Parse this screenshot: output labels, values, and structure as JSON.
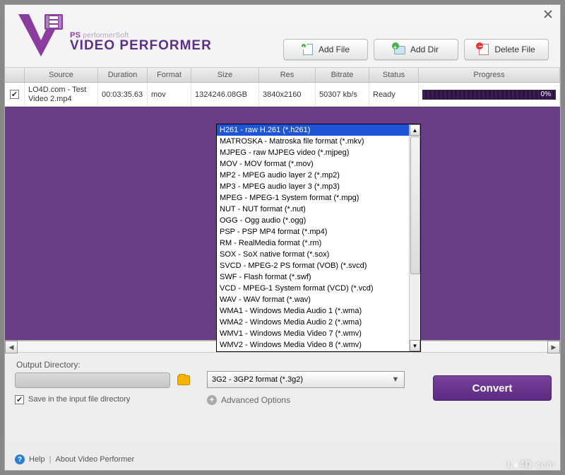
{
  "branding": {
    "sub_prefix": "PS",
    "sub_name": "performerSoft",
    "title": "VIDEO PERFORMER"
  },
  "toolbar": {
    "add_file": "Add File",
    "add_dir": "Add Dir",
    "delete_file": "Delete File"
  },
  "columns": {
    "source": "Source",
    "duration": "Duration",
    "format": "Format",
    "size": "Size",
    "res": "Res",
    "bitrate": "Bitrate",
    "status": "Status",
    "progress": "Progress"
  },
  "rows": [
    {
      "checked": true,
      "source": "LO4D.com - Test Video 2.mp4",
      "duration": "00:03:35.63",
      "format": "mov",
      "size": "1324246.08GB",
      "res": "3840x2160",
      "bitrate": "50307 kb/s",
      "status": "Ready",
      "progress": "0%"
    }
  ],
  "dropdown": {
    "selected": "H261 - raw H.261 (*.h261)",
    "items": [
      "H261 - raw H.261 (*.h261)",
      "MATROSKA - Matroska file format (*.mkv)",
      "MJPEG - raw MJPEG video (*.mjpeg)",
      "MOV - MOV format (*.mov)",
      "MP2 - MPEG audio layer 2 (*.mp2)",
      "MP3 - MPEG audio layer 3 (*.mp3)",
      "MPEG - MPEG-1 System format (*.mpg)",
      "NUT - NUT format (*.nut)",
      "OGG - Ogg audio (*.ogg)",
      "PSP - PSP MP4 format (*.mp4)",
      "RM - RealMedia format (*.rm)",
      "SOX - SoX native format (*.sox)",
      "SVCD - MPEG-2 PS format (VOB) (*.svcd)",
      "SWF - Flash format (*.swf)",
      "VCD - MPEG-1 System format (VCD) (*.vcd)",
      "WAV - WAV format (*.wav)",
      "WMA1 - Windows Media Audio 1 (*.wma)",
      "WMA2 - Windows Media Audio 2 (*.wma)",
      "WMV1 - Windows Media Video 7 (*.wmv)",
      "WMV2 - Windows Media Video 8 (*.wmv)"
    ],
    "current": "3G2 - 3GP2 format (*.3g2)"
  },
  "output": {
    "label": "Output Directory:",
    "save_label": "Save in the input file directory",
    "save_checked": true
  },
  "advanced_label": "Advanced Options",
  "convert_label": "Convert",
  "footer": {
    "help": "Help",
    "about": "About Video Performer"
  },
  "watermark": "LO4D.com"
}
